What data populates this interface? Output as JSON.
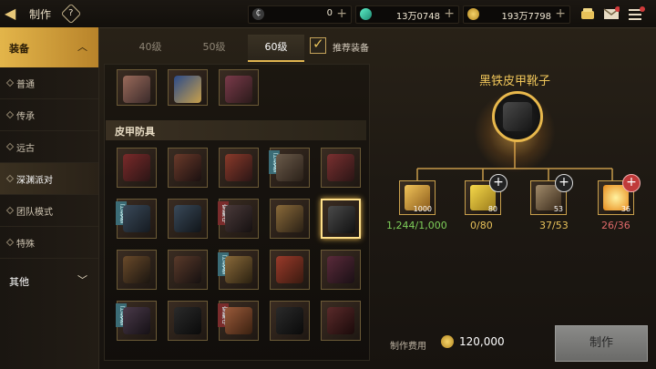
{
  "header": {
    "title": "制作",
    "help": "?",
    "currencies": [
      {
        "icon": "c-coin-icon",
        "value": "0"
      },
      {
        "icon": "gem-icon",
        "value": "13万0748"
      },
      {
        "icon": "gold-coin-icon",
        "value": "193万7798"
      }
    ]
  },
  "sidebar": {
    "top_group": "装备",
    "items": [
      "普通",
      "传承",
      "远古",
      "深渊派对",
      "团队模式",
      "特殊"
    ],
    "selected": "深渊派对",
    "bottom_group": "其他"
  },
  "tabs": [
    "40级",
    "50级",
    "60级"
  ],
  "selected_tab": "60级",
  "recommend_label": "推荐装备",
  "section_title": "皮甲防具",
  "item_tags": {
    "gray": "已装备",
    "red": "穿戴中"
  },
  "detail": {
    "item_name": "黑铁皮甲靴子",
    "materials": [
      {
        "qty": "1000",
        "count": "1,244/1,000",
        "color": "#7ecf5a"
      },
      {
        "qty": "80",
        "count": "0/80",
        "color": "#e8c25a"
      },
      {
        "qty": "53",
        "count": "37/53",
        "color": "#e8c25a"
      },
      {
        "qty": "36",
        "count": "26/36",
        "color": "#e06a6a"
      }
    ],
    "cost_label": "制作费用",
    "cost_value": "120,000",
    "craft_button": "制作"
  }
}
